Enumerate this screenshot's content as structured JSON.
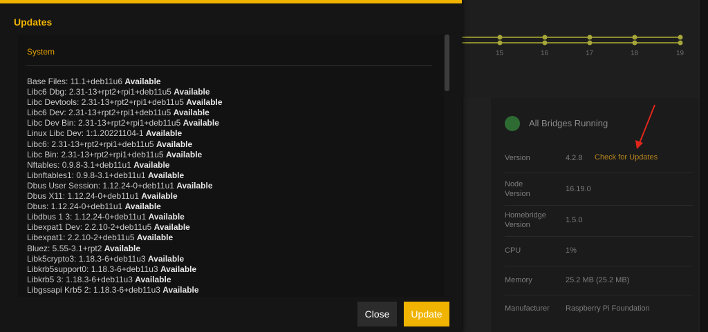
{
  "modal": {
    "title": "Updates",
    "section_title": "System",
    "status_label": "Available",
    "packages": [
      {
        "name": "Base Files: 11.1+deb11u6",
        "status": "Available"
      },
      {
        "name": "Libc6 Dbg: 2.31-13+rpt2+rpi1+deb11u5",
        "status": "Available"
      },
      {
        "name": "Libc Devtools: 2.31-13+rpt2+rpi1+deb11u5",
        "status": "Available"
      },
      {
        "name": "Libc6 Dev: 2.31-13+rpt2+rpi1+deb11u5",
        "status": "Available"
      },
      {
        "name": "Libc Dev Bin: 2.31-13+rpt2+rpi1+deb11u5",
        "status": "Available"
      },
      {
        "name": "Linux Libc Dev: 1:1.20221104-1",
        "status": "Available"
      },
      {
        "name": "Libc6: 2.31-13+rpt2+rpi1+deb11u5",
        "status": "Available"
      },
      {
        "name": "Libc Bin: 2.31-13+rpt2+rpi1+deb11u5",
        "status": "Available"
      },
      {
        "name": "Nftables: 0.9.8-3.1+deb11u1",
        "status": "Available"
      },
      {
        "name": "Libnftables1: 0.9.8-3.1+deb11u1",
        "status": "Available"
      },
      {
        "name": "Dbus User Session: 1.12.24-0+deb11u1",
        "status": "Available"
      },
      {
        "name": "Dbus X11: 1.12.24-0+deb11u1",
        "status": "Available"
      },
      {
        "name": "Dbus: 1.12.24-0+deb11u1",
        "status": "Available"
      },
      {
        "name": "Libdbus 1 3: 1.12.24-0+deb11u1",
        "status": "Available"
      },
      {
        "name": "Libexpat1 Dev: 2.2.10-2+deb11u5",
        "status": "Available"
      },
      {
        "name": "Libexpat1: 2.2.10-2+deb11u5",
        "status": "Available"
      },
      {
        "name": "Bluez: 5.55-3.1+rpt2",
        "status": "Available"
      },
      {
        "name": "Libk5crypto3: 1.18.3-6+deb11u3",
        "status": "Available"
      },
      {
        "name": "Libkrb5support0: 1.18.3-6+deb11u3",
        "status": "Available"
      },
      {
        "name": "Libkrb5 3: 1.18.3-6+deb11u3",
        "status": "Available"
      },
      {
        "name": "Libgssapi Krb5 2: 1.18.3-6+deb11u3",
        "status": "Available"
      }
    ],
    "buttons": {
      "close": "Close",
      "update": "Update"
    }
  },
  "background": {
    "chart_ticks": [
      "15",
      "16",
      "17",
      "18",
      "19"
    ],
    "status": {
      "text": "All Bridges Running",
      "color": "#2e6b33"
    },
    "info": {
      "version_label": "Version",
      "version_value": "4.2.8",
      "check_updates": "Check for Updates",
      "node_label": "Node\nVersion",
      "node_value": "16.19.0",
      "homebridge_label": "Homebridge\nVersion",
      "homebridge_value": "1.5.0",
      "cpu_label": "CPU",
      "cpu_value": "1%",
      "memory_label": "Memory",
      "memory_value": "25.2 MB (25.2 MB)",
      "manufacturer_label": "Manufacturer",
      "manufacturer_value": "Raspberry Pi Foundation"
    }
  },
  "colors": {
    "accent": "#f0b400",
    "annotation_arrow": "#e0261b"
  }
}
